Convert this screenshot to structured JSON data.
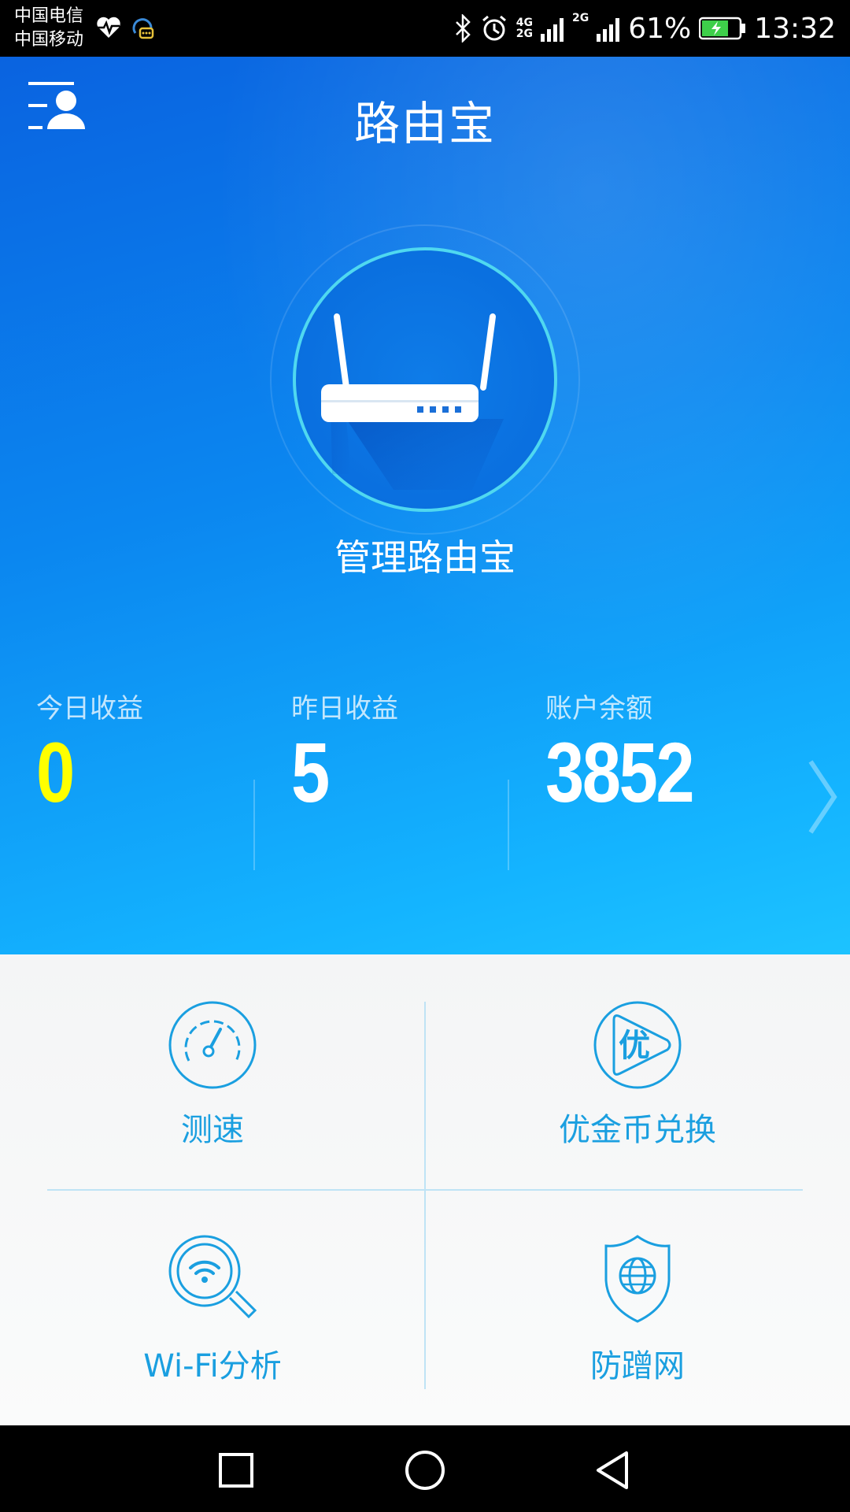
{
  "status_bar": {
    "carrier_1": "中国电信",
    "carrier_2": "中国移动",
    "network_1": "4G",
    "network_2": "2G",
    "network_3": "2G",
    "battery_percent": "61%",
    "time": "13:32",
    "icons": [
      "heart-rate-icon",
      "chat-bot-icon",
      "bluetooth-icon",
      "alarm-icon",
      "signal-icon",
      "battery-icon"
    ]
  },
  "header": {
    "title": "路由宝",
    "menu_icon": "user-menu-icon"
  },
  "hero": {
    "router_icon": "router-icon",
    "manage_label": "管理路由宝"
  },
  "stats": {
    "today": {
      "label": "今日收益",
      "value": "0"
    },
    "yesterday": {
      "label": "昨日收益",
      "value": "5"
    },
    "balance": {
      "label": "账户余额",
      "value": "3852"
    },
    "next_icon": "chevron-right-icon"
  },
  "features": [
    {
      "label": "测速",
      "icon": "speedometer-icon"
    },
    {
      "label": "优金币兑换",
      "icon": "coin-play-icon"
    },
    {
      "label": "Wi-Fi分析",
      "icon": "wifi-search-icon"
    },
    {
      "label": "防蹭网",
      "icon": "shield-globe-icon"
    }
  ],
  "colors": {
    "accent": "#1a9fe0",
    "today_value": "#ffff00",
    "hero_top": "#0a63e0",
    "hero_bottom": "#1dc3ff"
  },
  "nav_bar": {
    "icons": [
      "recent-apps-icon",
      "home-icon",
      "back-icon"
    ]
  }
}
